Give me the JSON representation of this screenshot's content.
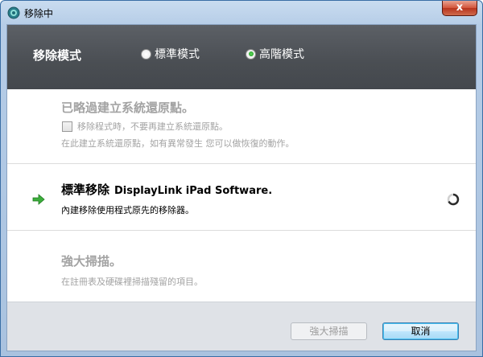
{
  "window": {
    "title": "移除中",
    "close_label": "x"
  },
  "header": {
    "mode_label": "移除模式",
    "options": [
      {
        "label": "標準模式",
        "checked": false
      },
      {
        "label": "高階模式",
        "checked": true
      }
    ]
  },
  "restore": {
    "title": "已略過建立系統還原點。",
    "checkbox_label": "移除程式時，不要再建立系統還原點。",
    "description": "在此建立系統還原點，如有異常發生 您可以做恢復的動作。"
  },
  "standard": {
    "title": "標準移除",
    "target": "DisplayLink iPad Software.",
    "description": "內建移除使用程式原先的移除器。"
  },
  "scan": {
    "title": "強大掃描。",
    "description": "在註冊表及硬碟裡掃描殘留的項目。"
  },
  "footer": {
    "scan_button": "強大掃描",
    "cancel_button": "取消"
  }
}
